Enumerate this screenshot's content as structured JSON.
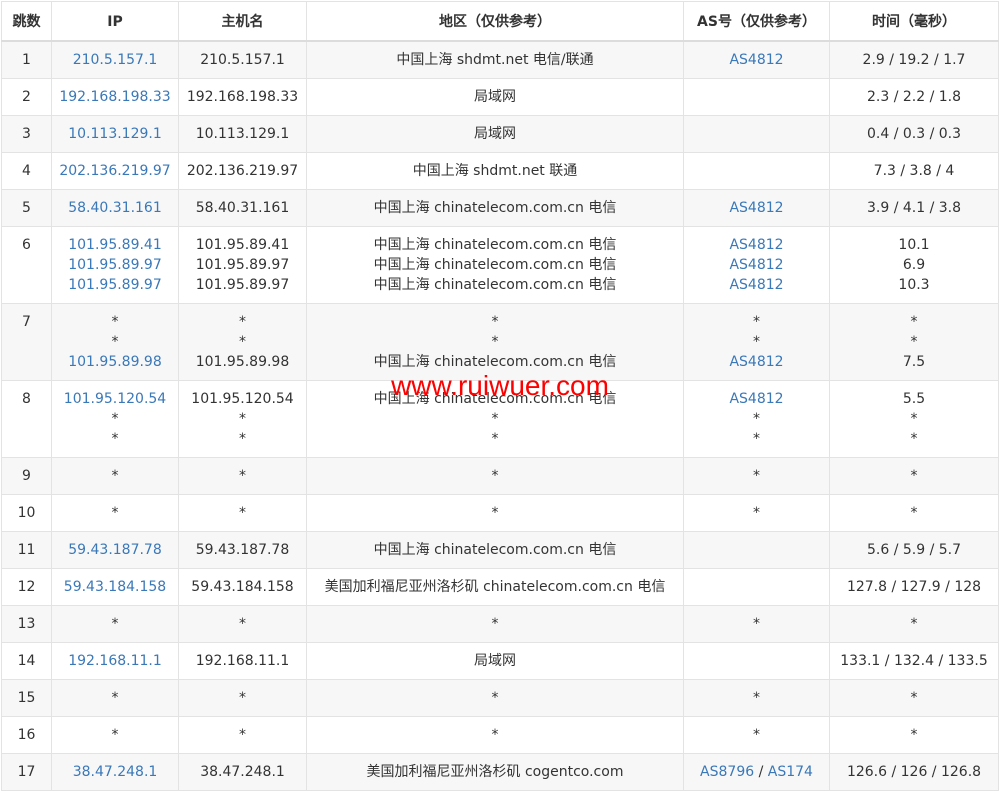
{
  "headers": [
    "跳数",
    "IP",
    "主机名",
    "地区（仅供参考）",
    "AS号（仅供参考）",
    "时间（毫秒）"
  ],
  "rows": [
    {
      "hop": "1",
      "ip": [
        "210.5.157.1"
      ],
      "host": [
        "210.5.157.1"
      ],
      "region": [
        "中国上海 shdmt.net 电信/联通"
      ],
      "as": [
        [
          "AS4812"
        ]
      ],
      "time": [
        "2.9 / 19.2 / 1.7"
      ]
    },
    {
      "hop": "2",
      "ip": [
        "192.168.198.33"
      ],
      "host": [
        "192.168.198.33"
      ],
      "region": [
        "局域网"
      ],
      "as": [
        []
      ],
      "time": [
        "2.3 / 2.2 / 1.8"
      ]
    },
    {
      "hop": "3",
      "ip": [
        "10.113.129.1"
      ],
      "host": [
        "10.113.129.1"
      ],
      "region": [
        "局域网"
      ],
      "as": [
        []
      ],
      "time": [
        "0.4 / 0.3 / 0.3"
      ]
    },
    {
      "hop": "4",
      "ip": [
        "202.136.219.97"
      ],
      "host": [
        "202.136.219.97"
      ],
      "region": [
        "中国上海 shdmt.net 联通"
      ],
      "as": [
        []
      ],
      "time": [
        "7.3 / 3.8 / 4"
      ]
    },
    {
      "hop": "5",
      "ip": [
        "58.40.31.161"
      ],
      "host": [
        "58.40.31.161"
      ],
      "region": [
        "中国上海 chinatelecom.com.cn 电信"
      ],
      "as": [
        [
          "AS4812"
        ]
      ],
      "time": [
        "3.9 / 4.1 / 3.8"
      ]
    },
    {
      "hop": "6",
      "ip": [
        "101.95.89.41",
        "101.95.89.97",
        "101.95.89.97"
      ],
      "host": [
        "101.95.89.41",
        "101.95.89.97",
        "101.95.89.97"
      ],
      "region": [
        "中国上海 chinatelecom.com.cn 电信",
        "中国上海 chinatelecom.com.cn 电信",
        "中国上海 chinatelecom.com.cn 电信"
      ],
      "as": [
        [
          "AS4812"
        ],
        [
          "AS4812"
        ],
        [
          "AS4812"
        ]
      ],
      "time": [
        "10.1",
        "6.9",
        "10.3"
      ]
    },
    {
      "hop": "7",
      "ip": [
        "*",
        "*",
        "101.95.89.98"
      ],
      "host": [
        "*",
        "*",
        "101.95.89.98"
      ],
      "region": [
        "*",
        "*",
        "中国上海 chinatelecom.com.cn 电信"
      ],
      "as": [
        [
          "*"
        ],
        [
          "*"
        ],
        [
          "AS4812"
        ]
      ],
      "time": [
        "*",
        "*",
        "7.5"
      ]
    },
    {
      "hop": "8",
      "ip": [
        "101.95.120.54",
        "*",
        "*"
      ],
      "host": [
        "101.95.120.54",
        "*",
        "*"
      ],
      "region": [
        "中国上海 chinatelecom.com.cn 电信",
        "*",
        "*"
      ],
      "as": [
        [
          "AS4812"
        ],
        [
          "*"
        ],
        [
          "*"
        ]
      ],
      "time": [
        "5.5",
        "*",
        "*"
      ]
    },
    {
      "hop": "9",
      "ip": [
        "*"
      ],
      "host": [
        "*"
      ],
      "region": [
        "*"
      ],
      "as": [
        [
          "*"
        ]
      ],
      "time": [
        "*"
      ]
    },
    {
      "hop": "10",
      "ip": [
        "*"
      ],
      "host": [
        "*"
      ],
      "region": [
        "*"
      ],
      "as": [
        [
          "*"
        ]
      ],
      "time": [
        "*"
      ]
    },
    {
      "hop": "11",
      "ip": [
        "59.43.187.78"
      ],
      "host": [
        "59.43.187.78"
      ],
      "region": [
        "中国上海 chinatelecom.com.cn 电信"
      ],
      "as": [
        []
      ],
      "time": [
        "5.6 / 5.9 / 5.7"
      ]
    },
    {
      "hop": "12",
      "ip": [
        "59.43.184.158"
      ],
      "host": [
        "59.43.184.158"
      ],
      "region": [
        "美国加利福尼亚州洛杉矶 chinatelecom.com.cn 电信"
      ],
      "as": [
        []
      ],
      "time": [
        "127.8 / 127.9 / 128"
      ]
    },
    {
      "hop": "13",
      "ip": [
        "*"
      ],
      "host": [
        "*"
      ],
      "region": [
        "*"
      ],
      "as": [
        [
          "*"
        ]
      ],
      "time": [
        "*"
      ]
    },
    {
      "hop": "14",
      "ip": [
        "192.168.11.1"
      ],
      "host": [
        "192.168.11.1"
      ],
      "region": [
        "局域网"
      ],
      "as": [
        []
      ],
      "time": [
        "133.1 / 132.4 / 133.5"
      ]
    },
    {
      "hop": "15",
      "ip": [
        "*"
      ],
      "host": [
        "*"
      ],
      "region": [
        "*"
      ],
      "as": [
        [
          "*"
        ]
      ],
      "time": [
        "*"
      ]
    },
    {
      "hop": "16",
      "ip": [
        "*"
      ],
      "host": [
        "*"
      ],
      "region": [
        "*"
      ],
      "as": [
        [
          "*"
        ]
      ],
      "time": [
        "*"
      ]
    },
    {
      "hop": "17",
      "ip": [
        "38.47.248.1"
      ],
      "host": [
        "38.47.248.1"
      ],
      "region": [
        "美国加利福尼亚州洛杉矶 cogentco.com"
      ],
      "as": [
        [
          "AS8796",
          "AS174"
        ]
      ],
      "time": [
        "126.6 / 126 / 126.8"
      ]
    }
  ],
  "watermark": "www.ruiwuer.com",
  "colors": {
    "link": "#3a78b8",
    "text": "#333333",
    "watermark": "#ff0000",
    "row_alt": "#f7f7f7",
    "border": "#e3e3e3"
  }
}
